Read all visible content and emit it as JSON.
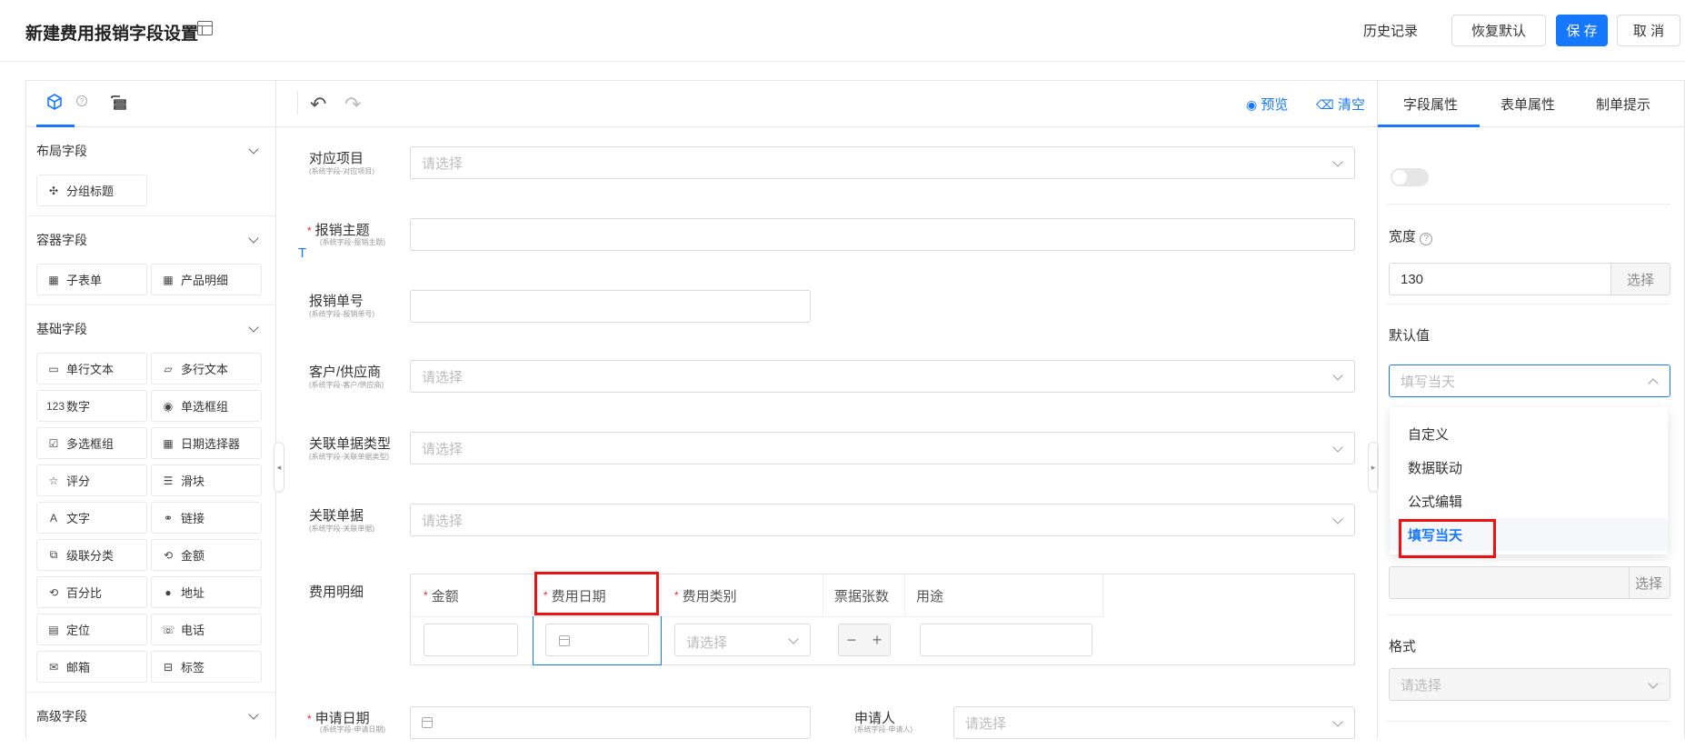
{
  "header": {
    "title": "新建费用报销字段设置",
    "history_label": "历史记录",
    "restore_label": "恢复默认",
    "save_label": "保 存",
    "cancel_label": "取 消"
  },
  "left_panel": {
    "tab_help": "?",
    "sections": [
      {
        "title": "布局字段",
        "items": [
          {
            "icon": "group-title-icon",
            "label": "分组标题"
          }
        ]
      },
      {
        "title": "容器字段",
        "items": [
          {
            "icon": "table-icon",
            "label": "子表单"
          },
          {
            "icon": "table-icon",
            "label": "产品明细"
          }
        ]
      },
      {
        "title": "基础字段",
        "items": [
          {
            "icon": "single-line-icon",
            "label": "单行文本"
          },
          {
            "icon": "multi-line-icon",
            "label": "多行文本"
          },
          {
            "icon": "number-icon",
            "label": "数字"
          },
          {
            "icon": "radio-icon",
            "label": "单选框组"
          },
          {
            "icon": "checkbox-icon",
            "label": "多选框组"
          },
          {
            "icon": "date-picker-icon",
            "label": "日期选择器"
          },
          {
            "icon": "star-icon",
            "label": "评分"
          },
          {
            "icon": "slider-icon",
            "label": "滑块"
          },
          {
            "icon": "text-icon",
            "label": "文字"
          },
          {
            "icon": "link-icon",
            "label": "链接"
          },
          {
            "icon": "cascade-icon",
            "label": "级联分类"
          },
          {
            "icon": "amount-icon",
            "label": "金额"
          },
          {
            "icon": "percent-icon",
            "label": "百分比"
          },
          {
            "icon": "location-pin-icon",
            "label": "地址"
          },
          {
            "icon": "position-icon",
            "label": "定位"
          },
          {
            "icon": "phone-icon",
            "label": "电话"
          },
          {
            "icon": "mail-icon",
            "label": "邮箱"
          },
          {
            "icon": "tag-icon",
            "label": "标签"
          }
        ]
      },
      {
        "title": "高级字段",
        "items": []
      }
    ],
    "icon_glyphs": {
      "group-title-icon": "✣",
      "table-icon": "▦",
      "single-line-icon": "▭",
      "multi-line-icon": "▱",
      "number-icon": "123",
      "radio-icon": "◉",
      "checkbox-icon": "☑",
      "date-picker-icon": "▦",
      "star-icon": "☆",
      "slider-icon": "☰",
      "text-icon": "A",
      "link-icon": "⚭",
      "cascade-icon": "⧉",
      "amount-icon": "⟲",
      "percent-icon": "⟲",
      "location-pin-icon": "●",
      "position-icon": "▤",
      "phone-icon": "☏",
      "mail-icon": "✉",
      "tag-icon": "⊟"
    }
  },
  "toolbar": {
    "preview_label": "预览",
    "clear_label": "清空"
  },
  "form": {
    "select_placeholder": "请选择",
    "fields": {
      "project": {
        "label": "对应项目",
        "sub": "(系统字段-对应项目)"
      },
      "subject": {
        "label": "报销主题",
        "sub": "(系统字段-报销主题)"
      },
      "number": {
        "label": "报销单号",
        "sub": "(系统字段-报销单号)"
      },
      "customer": {
        "label": "客户/供应商",
        "sub": "(系统字段-客户/供应商)"
      },
      "rel_type": {
        "label": "关联单据类型",
        "sub": "(系统字段-关联单据类型)"
      },
      "rel_doc": {
        "label": "关联单据",
        "sub": "(系统字段-关联单据)"
      },
      "detail": {
        "label": "费用明细"
      },
      "apply_date": {
        "label": "申请日期",
        "sub": "(系统字段-申请日期)"
      },
      "applicant": {
        "label": "申请人",
        "sub": "(系统字段-申请人)"
      }
    },
    "detail_table": {
      "columns": [
        "金额",
        "费用日期",
        "费用类别",
        "票据张数",
        "用途"
      ]
    }
  },
  "right_panel": {
    "tabs": [
      "字段属性",
      "表单属性",
      "制单提示"
    ],
    "width_label": "宽度",
    "width_value": "130",
    "select_button": "选择",
    "default_label": "默认值",
    "default_value": "填写当天",
    "dropdown_options": [
      "自定义",
      "数据联动",
      "公式编辑",
      "填写当天"
    ],
    "format_label": "格式",
    "format_placeholder": "请选择"
  },
  "colors": {
    "accent": "#1677ff",
    "required": "#f5222d",
    "highlight": "#e11111"
  }
}
